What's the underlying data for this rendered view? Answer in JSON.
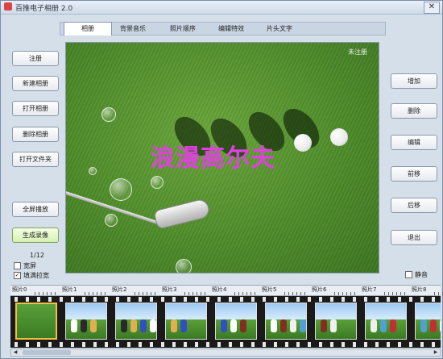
{
  "window": {
    "title": "百推电子相册 2.0",
    "close_label": "✕"
  },
  "tabs": [
    "相册",
    "背景音乐",
    "照片顺序",
    "编辑特效",
    "片头文字"
  ],
  "left_buttons": [
    "注册",
    "新建相册",
    "打开相册",
    "删除相册",
    "打开文件夹"
  ],
  "left_buttons_lower": {
    "fullscreen": "全屏播放",
    "record": "生成录像"
  },
  "counter": "1/12",
  "checkboxes": {
    "widescreen": "宽屏",
    "fill_stretch": "填满拉宽",
    "mute": "静音"
  },
  "checkbox_state": {
    "widescreen": false,
    "fill_stretch": true,
    "mute": false
  },
  "right_buttons": [
    "增加",
    "删除",
    "编辑",
    "前移",
    "后移",
    "退出"
  ],
  "preview": {
    "label": "未注册",
    "title": "浪漫高尔夫"
  },
  "ruler_labels": [
    "照片0",
    "照片1",
    "照片2",
    "照片3",
    "照片4",
    "照片5",
    "照片6",
    "照片7",
    "照片8"
  ],
  "filmstrip": {
    "selected_index": 0,
    "count": 9
  }
}
